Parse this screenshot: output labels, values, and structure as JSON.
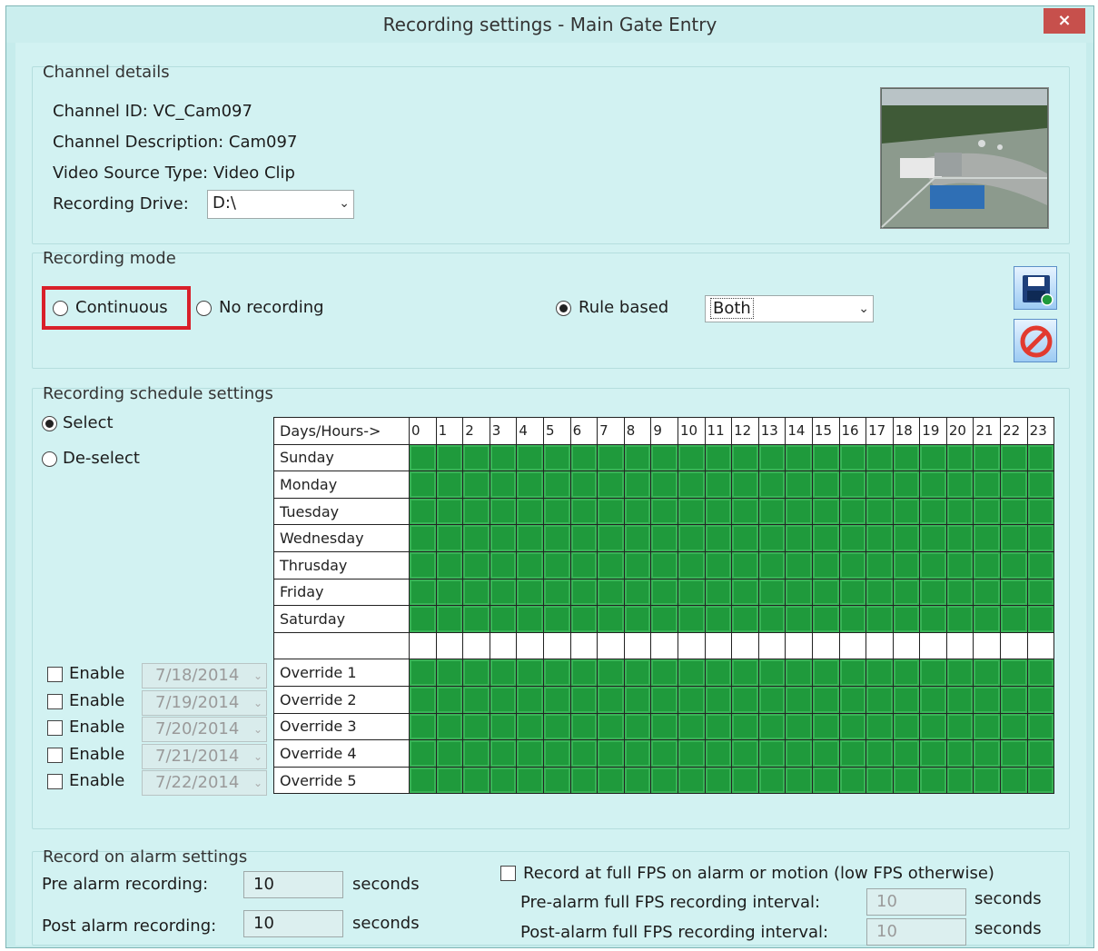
{
  "window": {
    "title": "Recording settings - Main Gate Entry",
    "close_glyph": "×"
  },
  "channel": {
    "group_title": "Channel details",
    "id_line": "Channel ID: VC_Cam097",
    "desc_line": "Channel Description: Cam097",
    "source_line": "Video Source Type: Video Clip",
    "drive_label": "Recording Drive:",
    "drive_value": "D:\\"
  },
  "mode": {
    "group_title": "Recording mode",
    "continuous": "Continuous",
    "no_recording": "No recording",
    "rule_based": "Rule based",
    "rule_value": "Both",
    "selected": "rule_based"
  },
  "schedule": {
    "group_title": "Recording schedule settings",
    "select_label": "Select",
    "deselect_label": "De-select",
    "header_label": "Days/Hours->",
    "hours": [
      "0",
      "1",
      "2",
      "3",
      "4",
      "5",
      "6",
      "7",
      "8",
      "9",
      "10",
      "11",
      "12",
      "13",
      "14",
      "15",
      "16",
      "17",
      "18",
      "19",
      "20",
      "21",
      "22",
      "23"
    ],
    "days": [
      "Sunday",
      "Monday",
      "Tuesday",
      "Wednesday",
      "Thrusday",
      "Friday",
      "Saturday"
    ],
    "overrides": [
      {
        "enable_label": "Enable",
        "date": "7/18/2014",
        "label": "Override 1"
      },
      {
        "enable_label": "Enable",
        "date": "7/19/2014",
        "label": "Override 2"
      },
      {
        "enable_label": "Enable",
        "date": "7/20/2014",
        "label": "Override 3"
      },
      {
        "enable_label": "Enable",
        "date": "7/21/2014",
        "label": "Override 4"
      },
      {
        "enable_label": "Enable",
        "date": "7/22/2014",
        "label": "Override 5"
      }
    ]
  },
  "alarm": {
    "group_title": "Record on alarm settings",
    "pre_label": "Pre alarm recording:",
    "pre_value": "10",
    "post_label": "Post alarm recording:",
    "post_value": "10",
    "unit": "seconds",
    "fullfps_label": "Record at full FPS on alarm or motion (low FPS otherwise)",
    "pre_fps_label": "Pre-alarm full FPS recording interval:",
    "pre_fps_value": "10",
    "post_fps_label": "Post-alarm full FPS recording interval:",
    "post_fps_value": "10"
  },
  "colors": {
    "accent_highlight": "#d9202a",
    "schedule_on": "#1f9a3c",
    "close": "#c7504c"
  },
  "icons": {
    "save": "save-disk-icon",
    "cancel": "cancel-circle-icon",
    "dropdown": "chevron-down-icon"
  }
}
